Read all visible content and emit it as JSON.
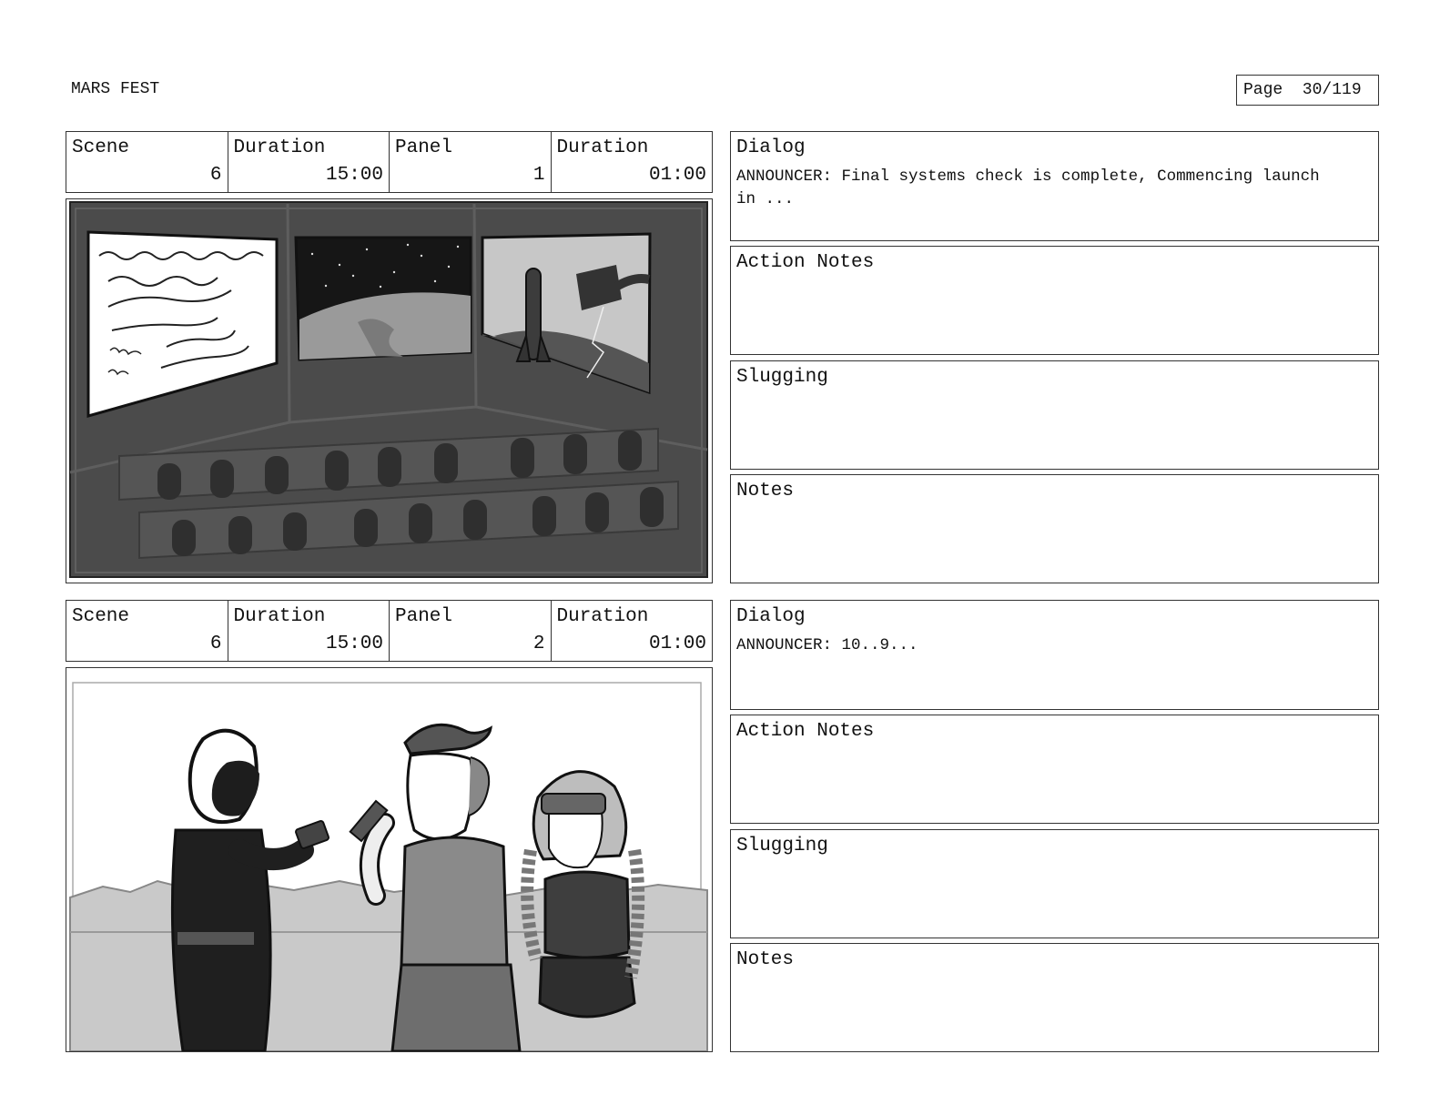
{
  "header": {
    "project_title": "MARS FEST",
    "page": "Page  30/119"
  },
  "labels": {
    "scene": "Scene",
    "duration": "Duration",
    "panel": "Panel",
    "dialog": "Dialog",
    "action_notes": "Action Notes",
    "slugging": "Slugging",
    "notes": "Notes"
  },
  "panels": [
    {
      "scene": "6",
      "scene_duration": "15:00",
      "panel": "1",
      "panel_duration": "01:00",
      "dialog": "ANNOUNCER: Final systems check is complete, Commencing launch in ...",
      "action_notes": "",
      "slugging": "",
      "notes": ""
    },
    {
      "scene": "6",
      "scene_duration": "15:00",
      "panel": "2",
      "panel_duration": "01:00",
      "dialog": "ANNOUNCER: 10..9...",
      "action_notes": "",
      "slugging": "",
      "notes": ""
    }
  ]
}
